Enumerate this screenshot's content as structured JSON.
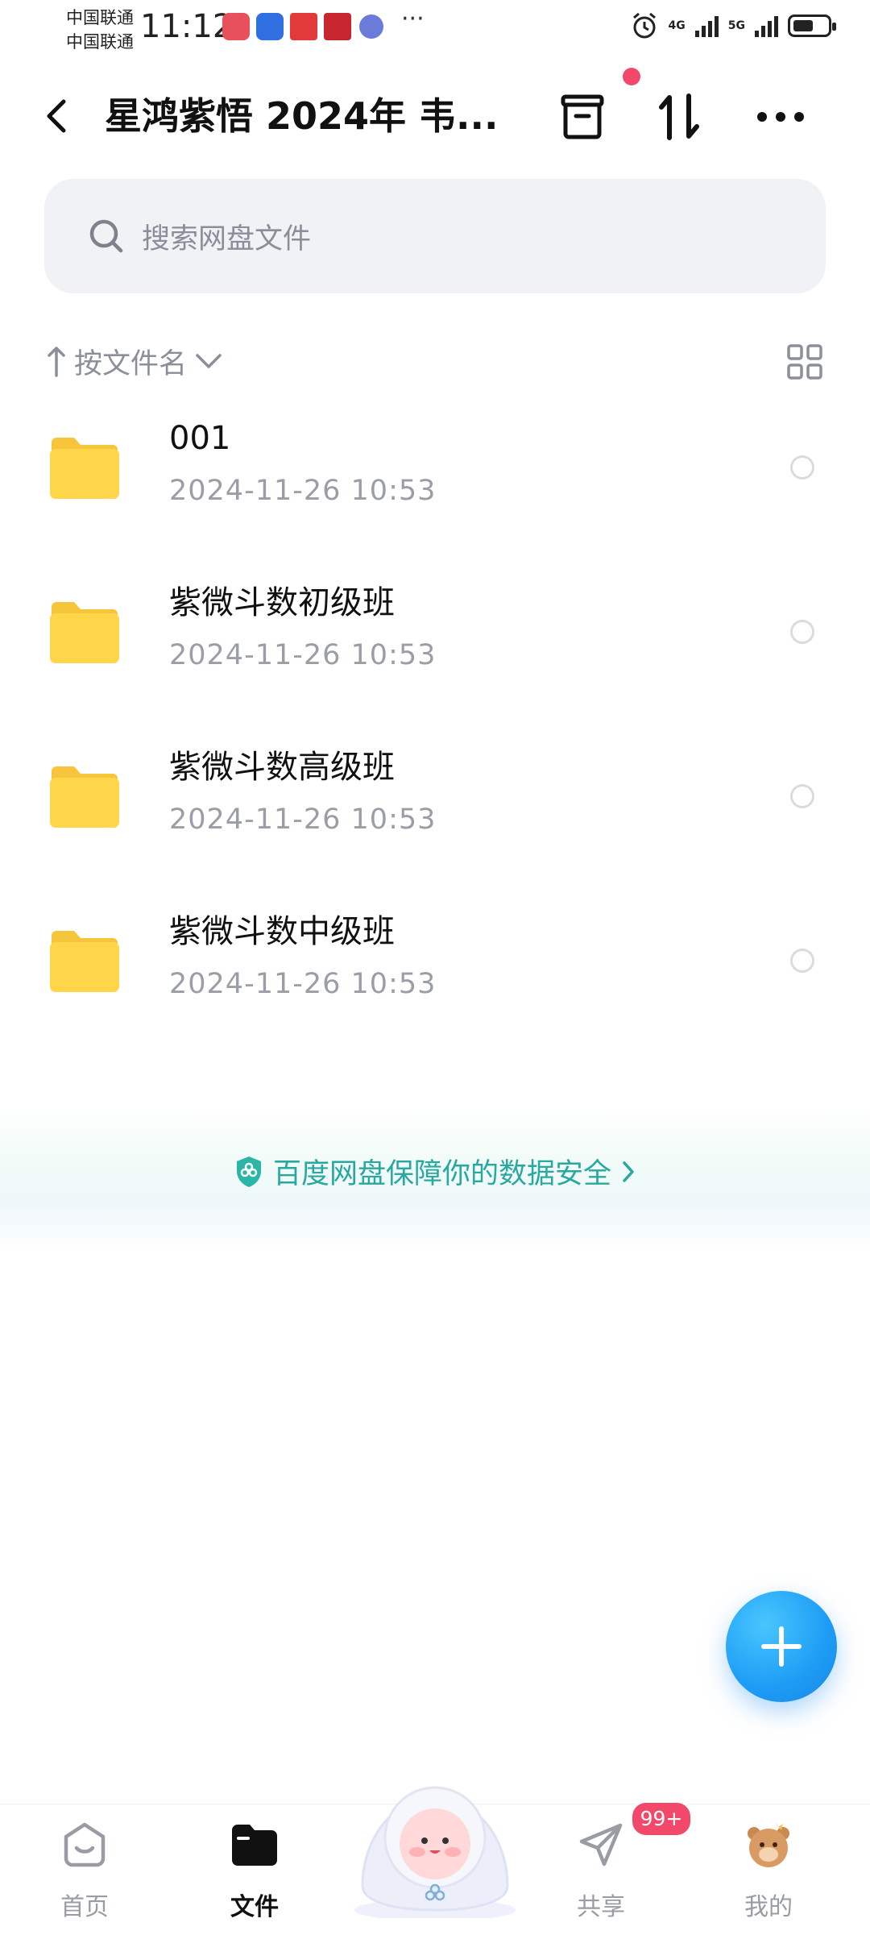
{
  "status_bar": {
    "carrier_1": "中国联通",
    "carrier_2": "中国联通",
    "time": "11:12",
    "more_dots": "···",
    "net_1": "4G",
    "net_2": "5G",
    "battery_level": 0.6
  },
  "header": {
    "title": "星鸿紫悟 2024年 韦..."
  },
  "search": {
    "placeholder": "搜索网盘文件"
  },
  "sort": {
    "label": "按文件名"
  },
  "files": [
    {
      "name": "001",
      "date": "2024-11-26  10:53"
    },
    {
      "name": "紫微斗数初级班",
      "date": "2024-11-26  10:53"
    },
    {
      "name": "紫微斗数高级班",
      "date": "2024-11-26  10:53"
    },
    {
      "name": "紫微斗数中级班",
      "date": "2024-11-26  10:53"
    }
  ],
  "banner": {
    "text": "百度网盘保障你的数据安全"
  },
  "bottom_nav": {
    "items": [
      {
        "label": "首页",
        "icon": "home-icon"
      },
      {
        "label": "文件",
        "icon": "folder-icon"
      },
      {
        "label": "共享",
        "icon": "send-icon"
      },
      {
        "label": "我的",
        "icon": "avatar-icon"
      }
    ],
    "share_badge": "99+"
  },
  "colors": {
    "accent": "#1e9cf5",
    "badge": "#f2486a",
    "folder": "#ffd54a",
    "banner_text": "#2aa8a0"
  }
}
